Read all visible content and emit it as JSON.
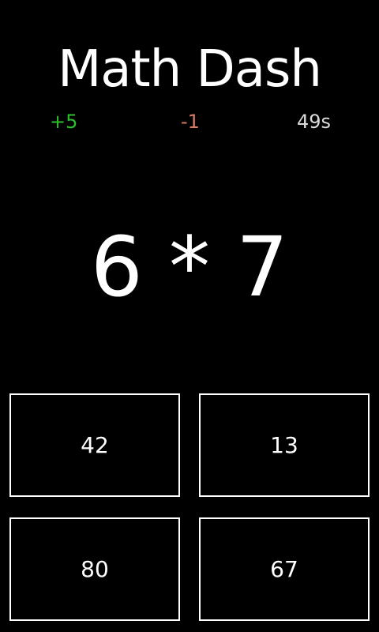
{
  "app": {
    "title": "Math Dash"
  },
  "stats": {
    "correct": "+5",
    "wrong": "-1",
    "timer": "49s"
  },
  "problem": {
    "expression": "6 * 7"
  },
  "answers": [
    {
      "label": "42"
    },
    {
      "label": "13"
    },
    {
      "label": "80"
    },
    {
      "label": "67"
    }
  ],
  "colors": {
    "background": "#000000",
    "text": "#ffffff",
    "correct": "#2ebf2e",
    "wrong": "#d97b63",
    "timer": "#d9d9d9",
    "button_border": "#ffffff"
  }
}
